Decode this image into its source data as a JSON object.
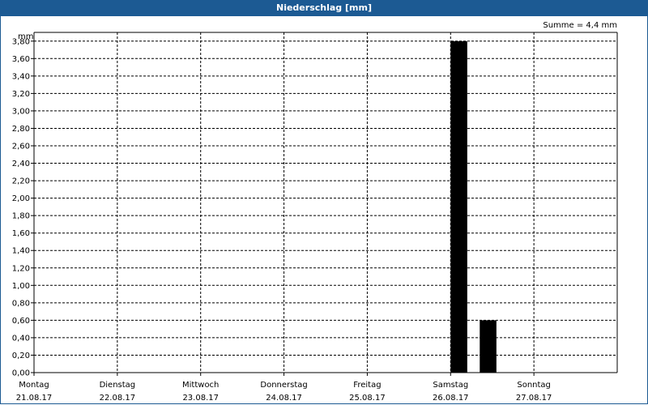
{
  "window": {
    "title": "Niederschlag [mm]"
  },
  "summary": {
    "text": "Summe = 4,4 mm"
  },
  "chart_data": {
    "type": "bar",
    "title": "Niederschlag [mm]",
    "ylabel": "mm",
    "ylim": [
      0,
      3.9
    ],
    "yticks": [
      0.0,
      0.2,
      0.4,
      0.6,
      0.8,
      1.0,
      1.2,
      1.4,
      1.6,
      1.8,
      2.0,
      2.2,
      2.4,
      2.6,
      2.8,
      3.0,
      3.2,
      3.4,
      3.6,
      3.8
    ],
    "ytick_labels": [
      "0,00",
      "0,20",
      "0,40",
      "0,60",
      "0,80",
      "1,00",
      "1,20",
      "1,40",
      "1,60",
      "1,80",
      "2,00",
      "2,20",
      "2,40",
      "2,60",
      "2,80",
      "3,00",
      "3,20",
      "3,40",
      "3,60",
      "3,80"
    ],
    "days": [
      {
        "name": "Montag",
        "date": "21.08.17"
      },
      {
        "name": "Dienstag",
        "date": "22.08.17"
      },
      {
        "name": "Mittwoch",
        "date": "23.08.17"
      },
      {
        "name": "Donnerstag",
        "date": "24.08.17"
      },
      {
        "name": "Freitag",
        "date": "25.08.17"
      },
      {
        "name": "Samstag",
        "date": "26.08.17"
      },
      {
        "name": "Sonntag",
        "date": "27.08.17"
      }
    ],
    "x_range_days": [
      0,
      7
    ],
    "bars": [
      {
        "x_start_days": 5.0,
        "x_end_days": 5.2,
        "value": 3.8
      },
      {
        "x_start_days": 5.35,
        "x_end_days": 5.55,
        "value": 0.6
      }
    ],
    "bar_color": "#000000",
    "grid": true,
    "grid_style": "dashed",
    "sum": 4.4
  }
}
